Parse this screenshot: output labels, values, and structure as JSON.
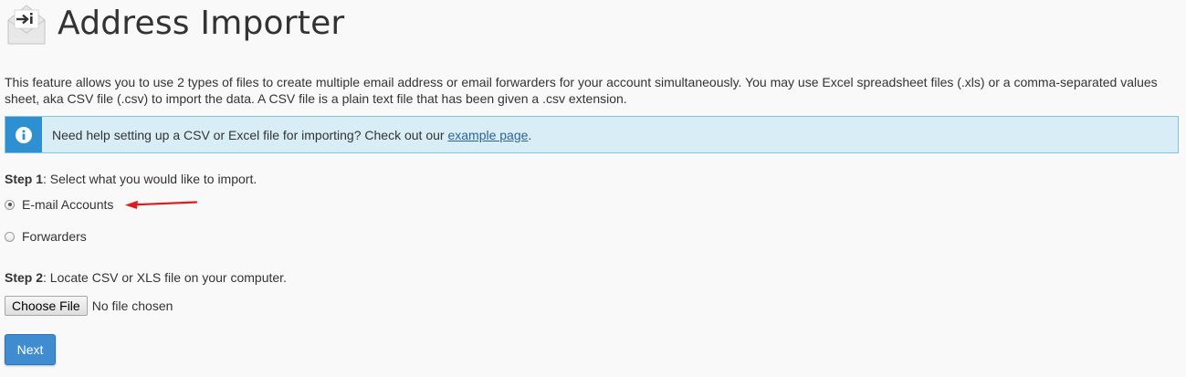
{
  "header": {
    "title": "Address Importer",
    "icon": "envelope-import-icon"
  },
  "description": "This feature allows you to use 2 types of files to create multiple email address or email forwarders for your account simultaneously. You may use Excel spreadsheet files (.xls) or a comma-separated values sheet, aka CSV file (.csv) to import the data. A CSV file is a plain text file that has been given a .csv extension.",
  "alert": {
    "icon": "info-icon",
    "text": "Need help setting up a CSV or Excel file for importing? Check out our ",
    "link_text": "example page",
    "suffix": "."
  },
  "step1": {
    "label": "Step 1",
    "text": ": Select what you would like to import.",
    "options": [
      {
        "label": "E-mail Accounts",
        "checked": true
      },
      {
        "label": "Forwarders",
        "checked": false
      }
    ]
  },
  "step2": {
    "label": "Step 2",
    "text": ": Locate CSV or XLS file on your computer.",
    "choose_label": "Choose File",
    "file_status": "No file chosen"
  },
  "next_label": "Next",
  "colors": {
    "accent": "#3f8dd0",
    "alert_bg": "#d9edf7",
    "annotation_arrow": "#e01b1b"
  }
}
